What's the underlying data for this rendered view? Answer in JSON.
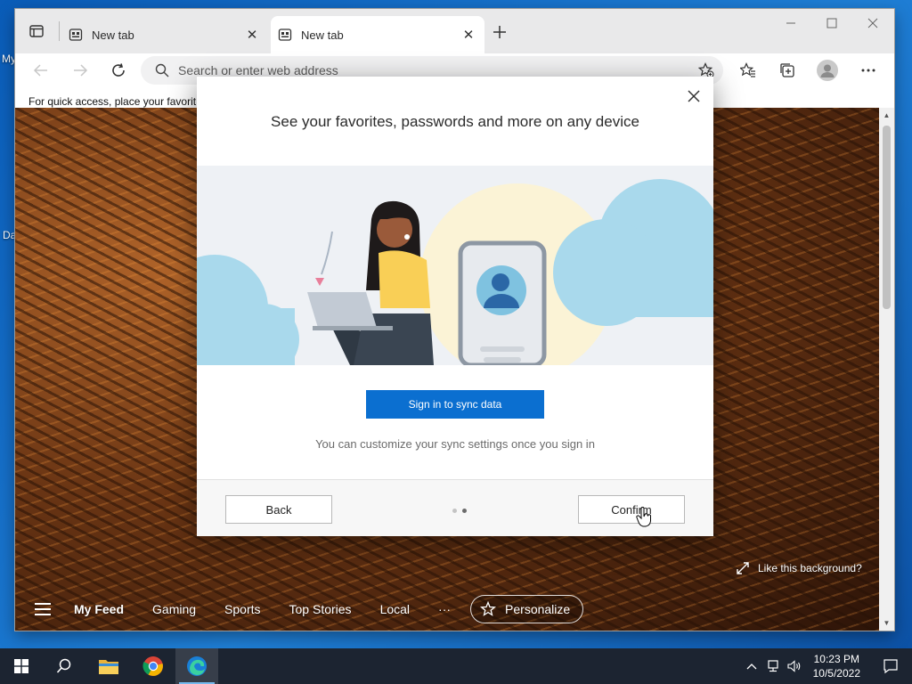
{
  "desktop": {
    "icon_labels": [
      "My",
      "Da"
    ]
  },
  "browser": {
    "tabs": [
      {
        "title": "New tab",
        "active": false
      },
      {
        "title": "New tab",
        "active": true
      }
    ],
    "address_placeholder": "Search or enter web address",
    "favorites_bar_text": "For quick access, place your favorit"
  },
  "new_tab_page": {
    "nav_items": [
      "My Feed",
      "Gaming",
      "Sports",
      "Top Stories",
      "Local",
      "···"
    ],
    "personalize_label": "Personalize",
    "like_background_label": "Like this background?"
  },
  "dialog": {
    "title": "See your favorites, passwords and more on any device",
    "primary_button": "Sign in to sync data",
    "subtext": "You can customize your sync settings once you sign in",
    "back_button": "Back",
    "confirm_button": "Confirm",
    "page_indicator": {
      "total": 2,
      "current": 2
    }
  },
  "taskbar": {
    "apps": [
      "start-icon",
      "search-icon",
      "file-explorer-icon",
      "chrome-icon",
      "edge-icon"
    ],
    "clock": {
      "time": "10:23 PM",
      "date": "10/5/2022"
    }
  },
  "colors": {
    "accent": "#0b6fd0",
    "taskbar": "#1c2431"
  }
}
